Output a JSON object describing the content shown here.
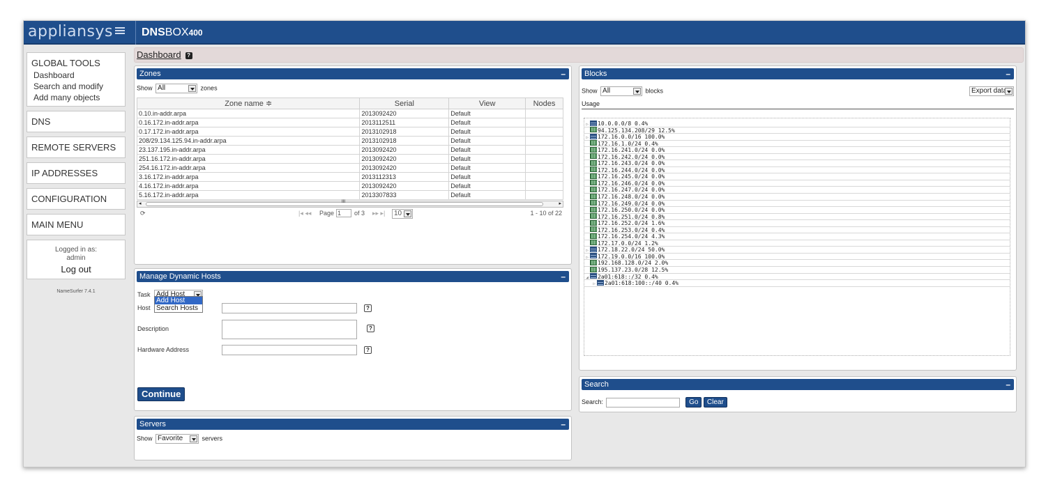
{
  "header": {
    "logo": "appliansys",
    "product_bold": "DNS",
    "product_rest": "BOX",
    "product_num": "400"
  },
  "sidebar": {
    "global_tools": "GLOBAL TOOLS",
    "global_items": [
      "Dashboard",
      "Search and modify",
      "Add many objects"
    ],
    "sections": [
      "DNS",
      "REMOTE SERVERS",
      "IP ADDRESSES",
      "CONFIGURATION",
      "MAIN MENU"
    ],
    "logged_in_as": "Logged in as:",
    "user": "admin",
    "logout": "Log out",
    "version": "NameSurfer 7.4.1"
  },
  "breadcrumb": {
    "label": "Dashboard",
    "help": "?"
  },
  "zones": {
    "title": "Zones",
    "collapse": "–",
    "show_label": "Show",
    "filter_value": "All",
    "filter_suffix": "zones",
    "columns": [
      "Zone name ≑",
      "Serial",
      "View",
      "Nodes"
    ],
    "rows": [
      [
        "0.10.in-addr.arpa",
        "2013092420",
        "Default",
        ""
      ],
      [
        "0.16.172.in-addr.arpa",
        "2013112511",
        "Default",
        ""
      ],
      [
        "0.17.172.in-addr.arpa",
        "2013102918",
        "Default",
        ""
      ],
      [
        "208/29.134.125.94.in-addr.arpa",
        "2013102918",
        "Default",
        ""
      ],
      [
        "23.137.195.in-addr.arpa",
        "2013092420",
        "Default",
        ""
      ],
      [
        "251.16.172.in-addr.arpa",
        "2013092420",
        "Default",
        ""
      ],
      [
        "254.16.172.in-addr.arpa",
        "2013092420",
        "Default",
        ""
      ],
      [
        "3.16.172.in-addr.arpa",
        "2013112313",
        "Default",
        ""
      ],
      [
        "4.16.172.in-addr.arpa",
        "2013092420",
        "Default",
        ""
      ],
      [
        "5.16.172.in-addr.arpa",
        "2013307833",
        "Default",
        ""
      ]
    ],
    "pager": {
      "page_label": "Page",
      "page_value": "1",
      "of": "of 3",
      "page_size": "10",
      "range": "1 - 10 of 22",
      "refresh": "⟳",
      "first_prev": "|◂ ◂◂",
      "next_last": "▸▸ ▸|",
      "scroll_mark": "III"
    }
  },
  "dynamic_hosts": {
    "title": "Manage Dynamic Hosts",
    "collapse": "–",
    "task_label": "Task",
    "task_value": "Add Host",
    "task_options": [
      "Add Host",
      "Search Hosts"
    ],
    "host_label": "Host",
    "description_label": "Description",
    "hardware_label": "Hardware Address",
    "help": "?",
    "continue": "Continue"
  },
  "servers": {
    "title": "Servers",
    "collapse": "–",
    "show_label": "Show",
    "filter_value": "Favorite",
    "filter_suffix": "servers"
  },
  "blocks": {
    "title": "Blocks",
    "collapse": "–",
    "show_label": "Show",
    "filter_value": "All",
    "filter_suffix": "blocks",
    "export_label": "Export data",
    "usage_label": "Usage",
    "rows": [
      {
        "label": "10.0.0.0/8 0.4%",
        "icon": "server",
        "indent": 0,
        "toggle": "▷"
      },
      {
        "label": "94.125.134.208/29 12.5%",
        "icon": "grid",
        "indent": 0,
        "toggle": ""
      },
      {
        "label": "172.16.0.0/16 100.0%",
        "icon": "server",
        "indent": 0,
        "toggle": "▷"
      },
      {
        "label": "172.16.1.0/24 0.4%",
        "icon": "grid",
        "indent": 0,
        "toggle": ""
      },
      {
        "label": "172.16.241.0/24 0.0%",
        "icon": "grid",
        "indent": 0,
        "toggle": ""
      },
      {
        "label": "172.16.242.0/24 0.0%",
        "icon": "grid",
        "indent": 0,
        "toggle": ""
      },
      {
        "label": "172.16.243.0/24 0.0%",
        "icon": "grid",
        "indent": 0,
        "toggle": ""
      },
      {
        "label": "172.16.244.0/24 0.0%",
        "icon": "grid",
        "indent": 0,
        "toggle": ""
      },
      {
        "label": "172.16.245.0/24 0.0%",
        "icon": "grid",
        "indent": 0,
        "toggle": ""
      },
      {
        "label": "172.16.246.0/24 0.0%",
        "icon": "grid",
        "indent": 0,
        "toggle": ""
      },
      {
        "label": "172.16.247.0/24 0.0%",
        "icon": "grid",
        "indent": 0,
        "toggle": ""
      },
      {
        "label": "172.16.248.0/24 0.0%",
        "icon": "grid",
        "indent": 0,
        "toggle": ""
      },
      {
        "label": "172.16.249.0/24 0.0%",
        "icon": "grid",
        "indent": 0,
        "toggle": ""
      },
      {
        "label": "172.16.250.0/24 0.0%",
        "icon": "grid",
        "indent": 0,
        "toggle": ""
      },
      {
        "label": "172.16.251.0/24 0.8%",
        "icon": "grid",
        "indent": 0,
        "toggle": ""
      },
      {
        "label": "172.16.252.0/24 1.6%",
        "icon": "grid",
        "indent": 0,
        "toggle": ""
      },
      {
        "label": "172.16.253.0/24 0.4%",
        "icon": "grid",
        "indent": 0,
        "toggle": ""
      },
      {
        "label": "172.16.254.0/24 4.3%",
        "icon": "grid",
        "indent": 0,
        "toggle": ""
      },
      {
        "label": "172.17.0.0/24 1.2%",
        "icon": "grid",
        "indent": 0,
        "toggle": ""
      },
      {
        "label": "172.18.22.0/24 50.0%",
        "icon": "server",
        "indent": 0,
        "toggle": "▷"
      },
      {
        "label": "172.19.0.0/16 100.0%",
        "icon": "server",
        "indent": 0,
        "toggle": "▷"
      },
      {
        "label": "192.168.128.0/24 2.0%",
        "icon": "grid",
        "indent": 0,
        "toggle": ""
      },
      {
        "label": "195.137.23.0/28 12.5%",
        "icon": "grid",
        "indent": 0,
        "toggle": ""
      },
      {
        "label": "2a01:618::/32 0.4%",
        "icon": "server",
        "indent": 0,
        "toggle": "◢"
      },
      {
        "label": "2a01:618:100::/40 0.4%",
        "icon": "server",
        "indent": 1,
        "toggle": "▷"
      }
    ]
  },
  "search": {
    "title": "Search",
    "collapse": "–",
    "label": "Search:",
    "go": "Go",
    "clear": "Clear"
  },
  "colors": {
    "primary": "#1f4e8c",
    "breadcrumb_bg": "#e3d9d9",
    "page_bg": "#e8e8e8"
  }
}
